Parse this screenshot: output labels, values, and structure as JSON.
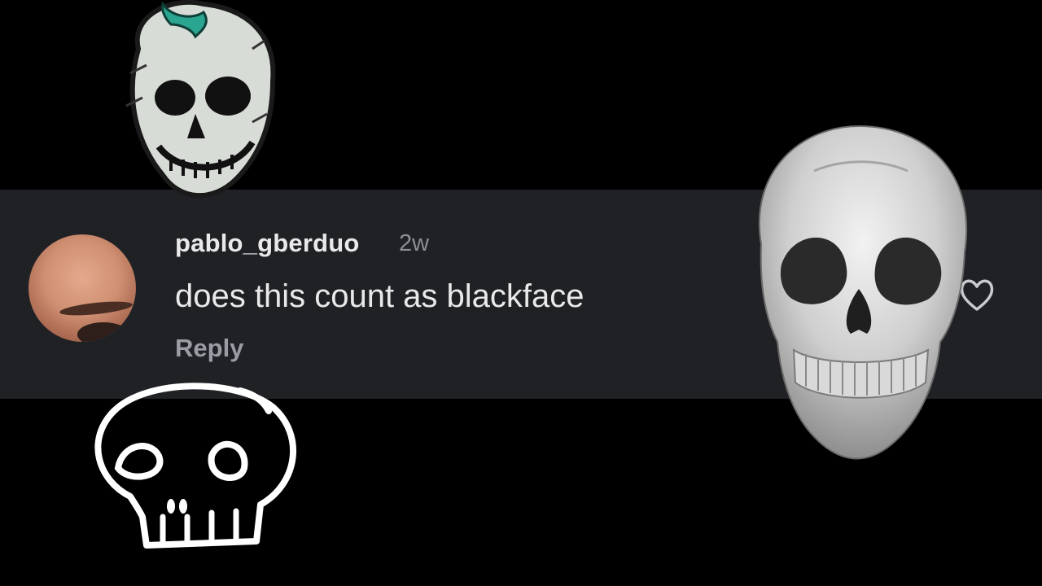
{
  "comment": {
    "username": "pablo_gberduo",
    "timestamp": "2w",
    "text": "does this count as blackface",
    "reply_label": "Reply"
  },
  "icons": {
    "like": "heart-icon",
    "avatar": "avatar",
    "stickers": [
      "skull-sticker-drawn",
      "skull-sticker-outline",
      "skull-photo-sticker"
    ]
  },
  "colors": {
    "background": "#000000",
    "comment_bar": "#1f2125",
    "primary_text": "#e9e9ea",
    "secondary_text": "#8c8f96",
    "sticker_accent": "#2aa58f"
  }
}
